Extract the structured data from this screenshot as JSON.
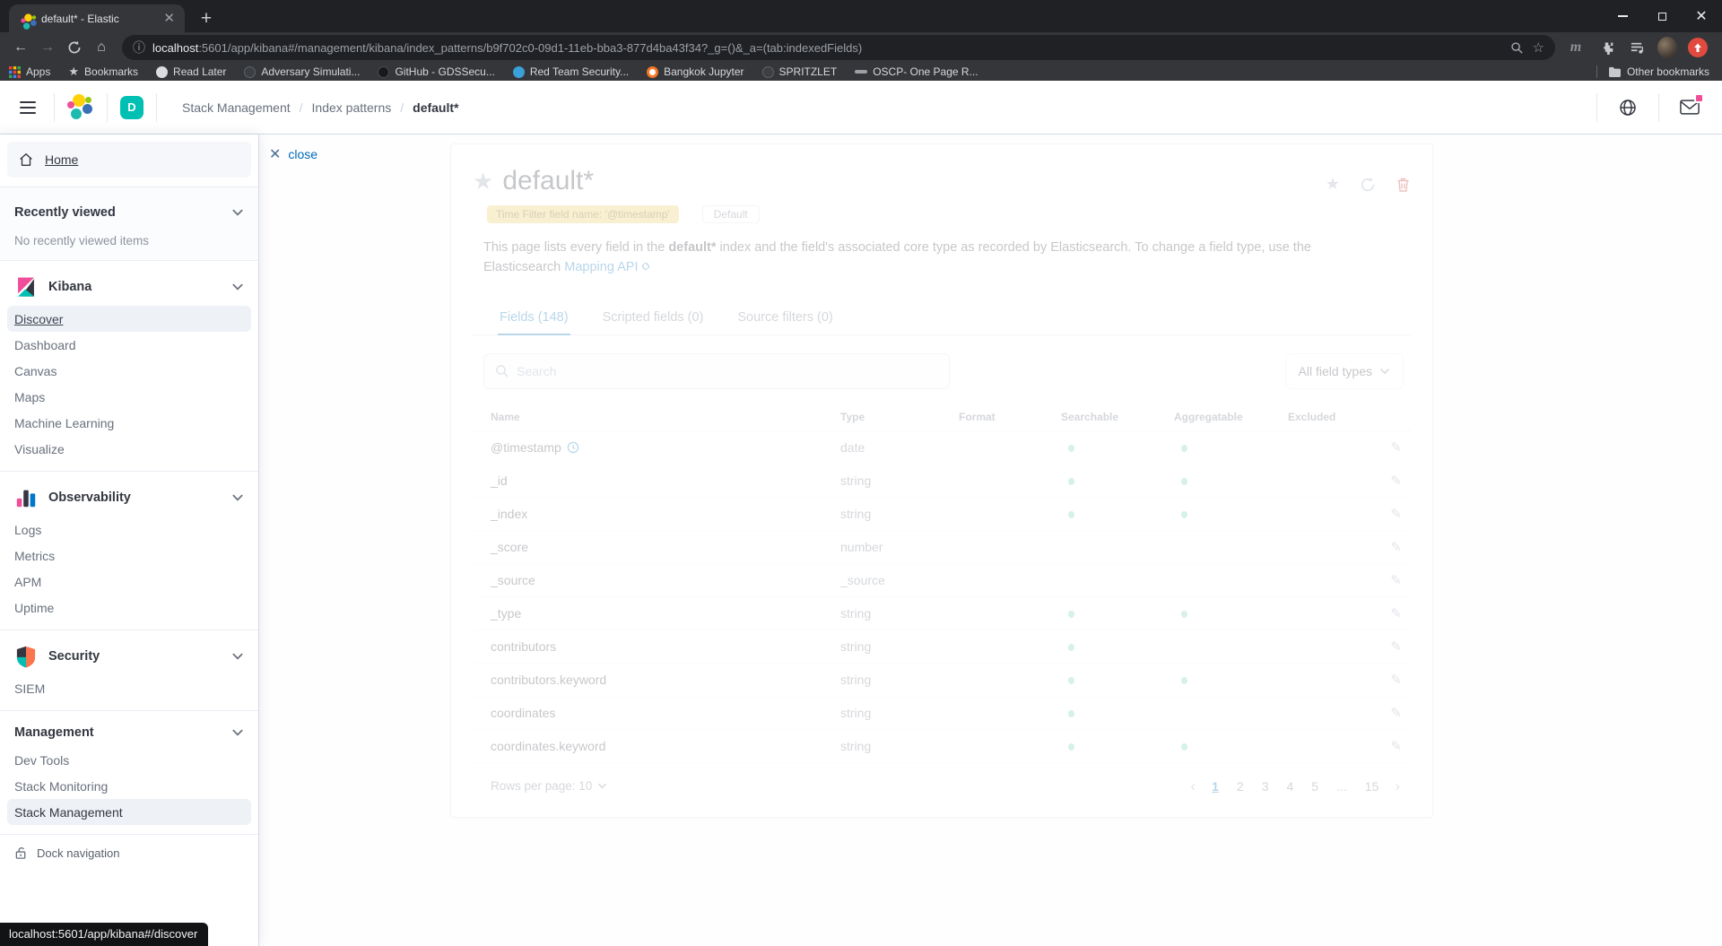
{
  "colors": {
    "accent_blue": "#006bb4",
    "space_badge_teal": "#00bfb3",
    "warning_badge_bg": "#e9c65a",
    "danger_red": "#bd271e",
    "searchable_dot_teal": "#6dccb1",
    "update_button_red": "#e04a3f",
    "newsfeed_dot_pink": "#f04e98"
  },
  "browser": {
    "tab_title": "default* - Elastic",
    "url_host": "localhost",
    "url_rest": ":5601/app/kibana#/management/kibana/index_patterns/b9f702c0-09d1-11eb-bba3-877d4ba43f34?_g=()&_a=(tab:indexedFields)",
    "bookmarks": [
      "Apps",
      "Bookmarks",
      "Read Later",
      "Adversary Simulati...",
      "GitHub - GDSSecu...",
      "Red Team Security...",
      "Bangkok Jupyter",
      "SPRITZLET",
      "OSCP- One Page R..."
    ],
    "other_bookmarks": "Other bookmarks",
    "status_tooltip": "localhost:5601/app/kibana#/discover"
  },
  "header": {
    "space_initial": "D",
    "breadcrumbs": [
      "Stack Management",
      "Index patterns",
      "default*"
    ]
  },
  "nav": {
    "home": "Home",
    "recently_viewed_title": "Recently viewed",
    "recently_viewed_empty": "No recently viewed items",
    "groups": [
      {
        "title": "Kibana",
        "items": [
          "Discover",
          "Dashboard",
          "Canvas",
          "Maps",
          "Machine Learning",
          "Visualize"
        ]
      },
      {
        "title": "Observability",
        "items": [
          "Logs",
          "Metrics",
          "APM",
          "Uptime"
        ]
      },
      {
        "title": "Security",
        "items": [
          "SIEM"
        ]
      },
      {
        "title": "Management",
        "items": [
          "Dev Tools",
          "Stack Monitoring",
          "Stack Management"
        ]
      }
    ],
    "dock_label": "Dock navigation",
    "close_label": "close"
  },
  "main": {
    "title": "default*",
    "time_filter_badge": "Time Filter field name: '@timestamp'",
    "default_badge": "Default",
    "description": {
      "part1": "This page lists every field in the ",
      "bold": "default*",
      "part2": " index and the field's associated core type as recorded by Elasticsearch. To change a field type, use the Elasticsearch ",
      "link": "Mapping API"
    },
    "tabs": [
      "Fields (148)",
      "Scripted fields (0)",
      "Source filters (0)"
    ],
    "search_placeholder": "Search",
    "field_type_filter": "All field types",
    "table": {
      "headers": [
        "Name",
        "Type",
        "Format",
        "Searchable",
        "Aggregatable",
        "Excluded"
      ],
      "rows": [
        {
          "name": "@timestamp",
          "time_field": true,
          "type": "date",
          "searchable": true,
          "aggregatable": true
        },
        {
          "name": "_id",
          "type": "string",
          "searchable": true,
          "aggregatable": true
        },
        {
          "name": "_index",
          "type": "string",
          "searchable": true,
          "aggregatable": true
        },
        {
          "name": "_score",
          "type": "number",
          "searchable": false,
          "aggregatable": false
        },
        {
          "name": "_source",
          "type": "_source",
          "searchable": false,
          "aggregatable": false
        },
        {
          "name": "_type",
          "type": "string",
          "searchable": true,
          "aggregatable": true
        },
        {
          "name": "contributors",
          "type": "string",
          "searchable": true,
          "aggregatable": false
        },
        {
          "name": "contributors.keyword",
          "type": "string",
          "searchable": true,
          "aggregatable": true
        },
        {
          "name": "coordinates",
          "type": "string",
          "searchable": true,
          "aggregatable": false
        },
        {
          "name": "coordinates.keyword",
          "type": "string",
          "searchable": true,
          "aggregatable": true
        }
      ]
    },
    "footer": {
      "rows_per_page": "Rows per page: 10",
      "pages": [
        "1",
        "2",
        "3",
        "4",
        "5",
        "...",
        "15"
      ],
      "active_page": "1"
    }
  }
}
